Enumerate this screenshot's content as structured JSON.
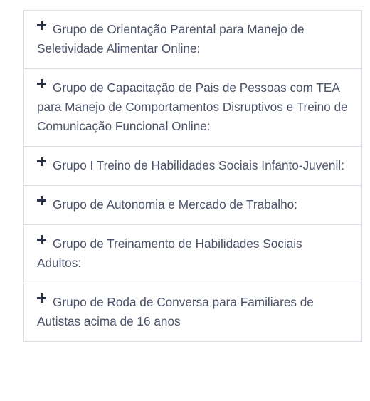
{
  "accordion": {
    "items": [
      {
        "title": "Grupo de Orientação Parental para Manejo de Seletividade Alimentar Online:",
        "icon": "plus-icon"
      },
      {
        "title": "Grupo de Capacitação de Pais de Pessoas com TEA para Manejo de Comportamentos Disruptivos e Treino de Comunicação Funcional Online:",
        "icon": "plus-icon"
      },
      {
        "title": "Grupo I Treino de Habilidades Sociais Infanto-Juvenil:",
        "icon": "plus-icon"
      },
      {
        "title": "Grupo de Autonomia e Mercado de Trabalho:",
        "icon": "plus-icon"
      },
      {
        "title": "Grupo de Treinamento de Habilidades Sociais Adultos:",
        "icon": "plus-icon"
      },
      {
        "title": "Grupo de Roda de Conversa para Familiares de Autistas acima de 16 anos",
        "icon": "plus-icon"
      }
    ]
  },
  "colors": {
    "text": "#4b5168",
    "icon": "#2a3045",
    "border": "#d9dde4"
  }
}
